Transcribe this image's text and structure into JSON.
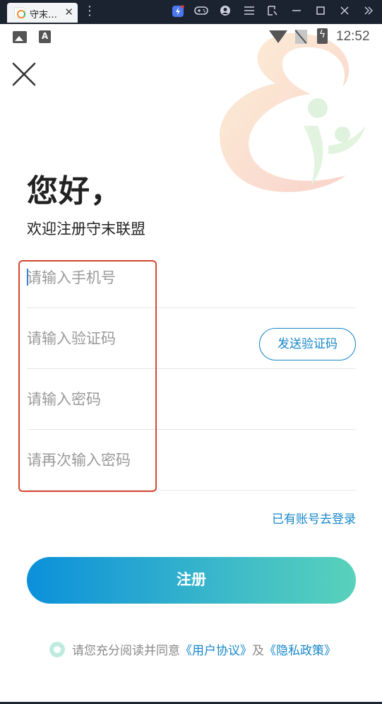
{
  "emulator": {
    "tab_title": "守末…",
    "tab_close": "✕",
    "kebab": "⋮",
    "icons": [
      "bolt-app-icon",
      "gamepad-icon",
      "account-icon",
      "menu-icon",
      "crop-icon",
      "minimize-icon",
      "maximize-icon",
      "close-window-icon",
      "expand-icon"
    ]
  },
  "status_bar": {
    "time": "12:52",
    "a_icon_letter": "A",
    "icons": [
      "image-icon",
      "a-notification-icon",
      "wifi-icon",
      "no-sim-icon",
      "battery-charging-icon"
    ]
  },
  "page": {
    "greeting": "您好，",
    "subtitle": "欢迎注册守末联盟"
  },
  "form": {
    "phone_placeholder": "请输入手机号",
    "phone_value": "",
    "code_placeholder": "请输入验证码",
    "code_value": "",
    "send_code_label": "发送验证码",
    "password_placeholder": "请输入密码",
    "password_value": "",
    "confirm_placeholder": "请再次输入密码",
    "confirm_value": ""
  },
  "login_link": "已有账号去登录",
  "register_label": "注册",
  "agreement": {
    "prefix": "请您充分阅读并同意",
    "user_agreement": "《用户协议》",
    "and": "及",
    "privacy_policy": "《隐私政策》"
  },
  "colors": {
    "accent": "#1787c9",
    "gradient_start": "#0b90da",
    "gradient_end": "#58d2bb",
    "highlight_box": "#d6472f"
  }
}
